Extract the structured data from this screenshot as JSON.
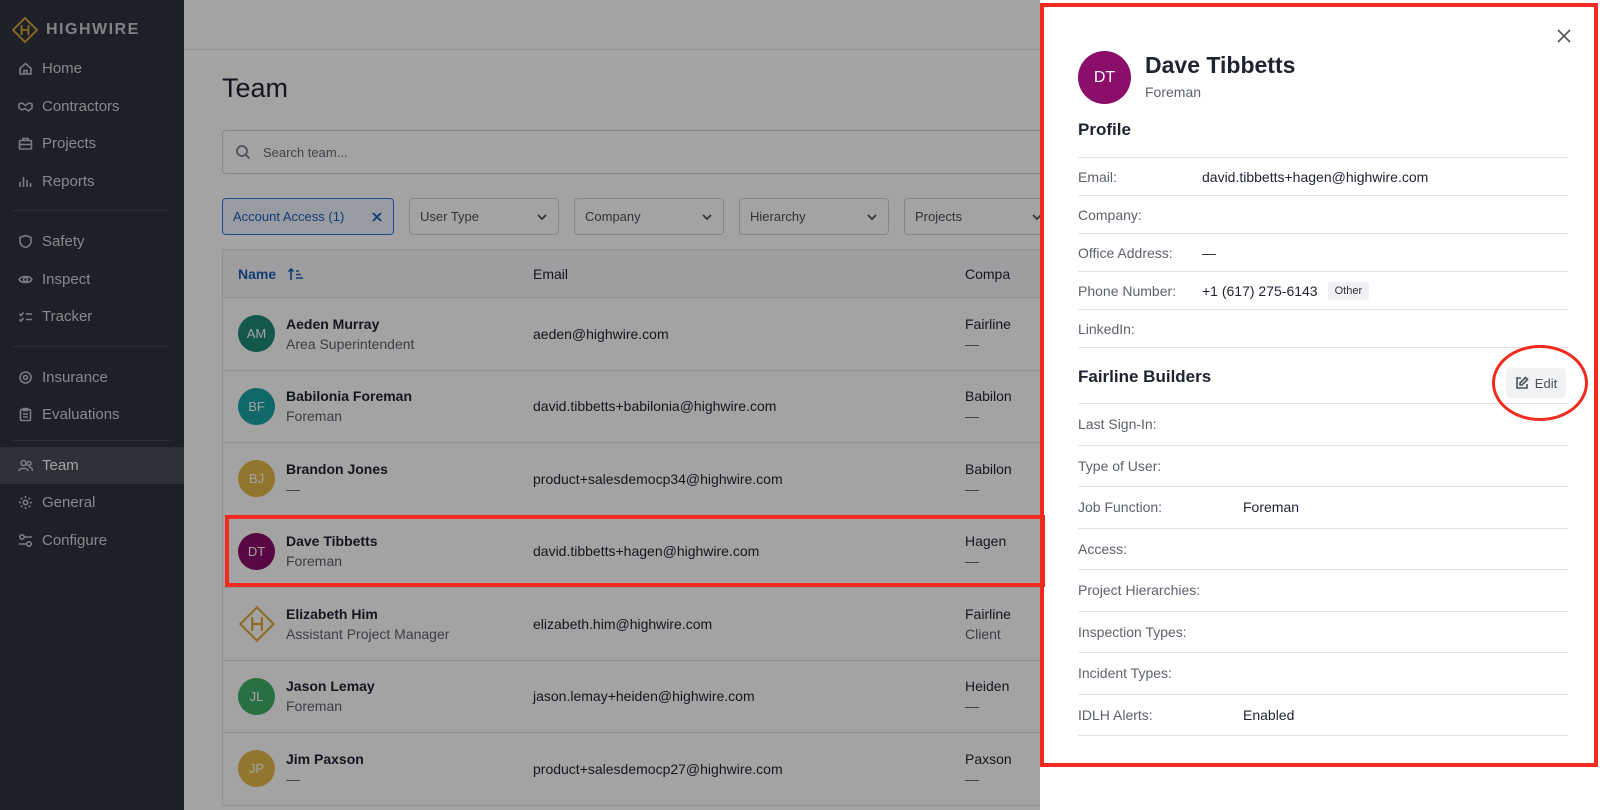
{
  "brand": {
    "name": "HIGHWIRE"
  },
  "sidebar": {
    "groups": [
      [
        {
          "label": "Home",
          "icon": "home-icon"
        },
        {
          "label": "Contractors",
          "icon": "handshake-icon"
        },
        {
          "label": "Projects",
          "icon": "briefcase-icon"
        },
        {
          "label": "Reports",
          "icon": "bar-chart-icon"
        }
      ],
      [
        {
          "label": "Safety",
          "icon": "shield-icon"
        },
        {
          "label": "Inspect",
          "icon": "eye-icon"
        },
        {
          "label": "Tracker",
          "icon": "check-list-icon"
        }
      ],
      [
        {
          "label": "Insurance",
          "icon": "umbrella-icon"
        },
        {
          "label": "Evaluations",
          "icon": "clipboard-icon"
        }
      ],
      [
        {
          "label": "Team",
          "icon": "users-icon",
          "active": true
        },
        {
          "label": "General",
          "icon": "gear-icon"
        },
        {
          "label": "Configure",
          "icon": "sliders-icon"
        }
      ]
    ]
  },
  "main": {
    "title": "Team",
    "search_placeholder": "Search team...",
    "filters": [
      {
        "label": "Account Access (1)",
        "active": true
      },
      {
        "label": "User Type"
      },
      {
        "label": "Company"
      },
      {
        "label": "Hierarchy"
      },
      {
        "label": "Projects"
      }
    ],
    "columns": {
      "name": "Name",
      "email": "Email",
      "company": "Compa"
    },
    "rows": [
      {
        "initials": "AM",
        "color": "#1e8a76",
        "name": "Aeden Murray",
        "role": "Area Superintendent",
        "email": "aeden@highwire.com",
        "company": "Fairline",
        "company_sub": "—"
      },
      {
        "initials": "BF",
        "color": "#1aa3a3",
        "name": "Babilonia Foreman",
        "role": "Foreman",
        "email": "david.tibbetts+babilonia@highwire.com",
        "company": "Babilon",
        "company_sub": "—"
      },
      {
        "initials": "BJ",
        "color": "#e5b94a",
        "name": "Brandon Jones",
        "role": "—",
        "email": "product+salesdemocp34@highwire.com",
        "company": "Babilon",
        "company_sub": "—"
      },
      {
        "initials": "DT",
        "color": "#8b0e6b",
        "name": "Dave Tibbetts",
        "role": "Foreman",
        "email": "david.tibbetts+hagen@highwire.com",
        "company": "Hagen",
        "company_sub": "—"
      },
      {
        "initials": "",
        "color": "logo",
        "name": "Elizabeth Him",
        "role": "Assistant Project Manager",
        "email": "elizabeth.him@highwire.com",
        "company": "Fairline",
        "company_sub": "Client"
      },
      {
        "initials": "JL",
        "color": "#3fae69",
        "name": "Jason Lemay",
        "role": "Foreman",
        "email": "jason.lemay+heiden@highwire.com",
        "company": "Heiden",
        "company_sub": "—"
      },
      {
        "initials": "JP",
        "color": "#e5b94a",
        "name": "Jim Paxson",
        "role": "—",
        "email": "product+salesdemocp27@highwire.com",
        "company": "Paxson",
        "company_sub": "—"
      }
    ]
  },
  "drawer": {
    "initials": "DT",
    "name": "Dave Tibbetts",
    "role": "Foreman",
    "profile_title": "Profile",
    "profile_fields": [
      {
        "label": "Email:",
        "value": "david.tibbetts+hagen@highwire.com"
      },
      {
        "label": "Company:",
        "value": ""
      },
      {
        "label": "Office Address:",
        "value": "—"
      },
      {
        "label": "Phone Number:",
        "value": "+1 (617) 275-6143",
        "tag": "Other"
      },
      {
        "label": "LinkedIn:",
        "value": ""
      }
    ],
    "company_title": "Fairline Builders",
    "edit_label": "Edit",
    "company_fields": [
      {
        "label": "Last Sign-In:",
        "value": ""
      },
      {
        "label": "Type of User:",
        "value": ""
      },
      {
        "label": "Job Function:",
        "value": "Foreman"
      },
      {
        "label": "Access:",
        "value": ""
      },
      {
        "label": "Project Hierarchies:",
        "value": ""
      },
      {
        "label": "Inspection Types:",
        "value": ""
      },
      {
        "label": "Incident Types:",
        "value": ""
      },
      {
        "label": "IDLH Alerts:",
        "value": "Enabled"
      }
    ]
  }
}
